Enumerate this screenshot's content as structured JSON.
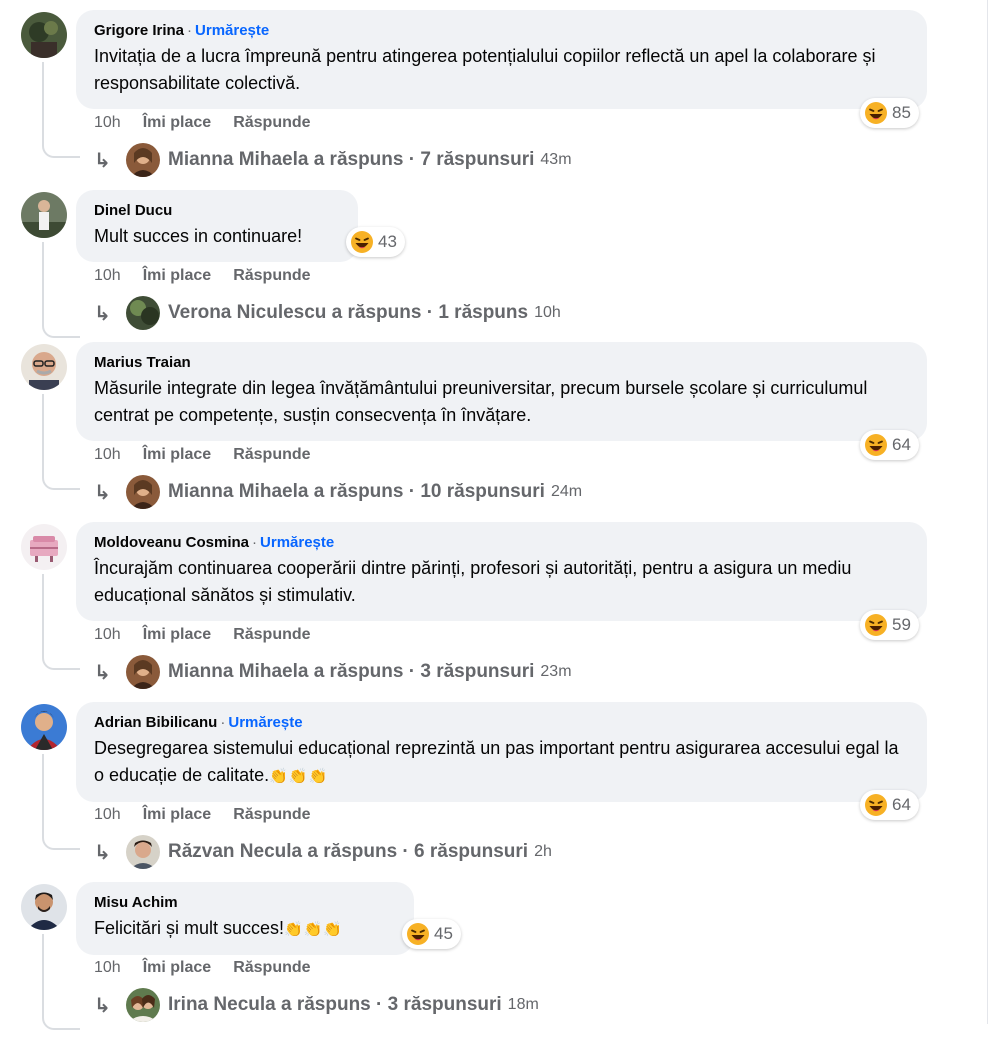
{
  "comments": [
    {
      "author": "Grigore Irina",
      "follow": "Urmărește",
      "text": "Invitația de a lucra împreună pentru atingerea potențialului copiilor reflectă un apel la colaborare și responsabilitate colectivă.",
      "reaction_count": "85",
      "time": "10h",
      "like": "Îmi place",
      "reply": "Răspunde",
      "reply_summary": "Mianna Mihaela a răspuns · 7 răspunsuri",
      "reply_time": "43m"
    },
    {
      "author": "Dinel Ducu",
      "follow": "",
      "text": "Mult succes in continuare!",
      "reaction_count": "43",
      "time": "10h",
      "like": "Îmi place",
      "reply": "Răspunde",
      "reply_summary": "Verona Niculescu a răspuns · 1 răspuns",
      "reply_time": "10h"
    },
    {
      "author": "Marius Traian",
      "follow": "",
      "text": "Măsurile integrate din legea învățământului preuniversitar, precum bursele școlare și curriculumul centrat pe competențe, susțin consecvența în învățare.",
      "reaction_count": "64",
      "time": "10h",
      "like": "Îmi place",
      "reply": "Răspunde",
      "reply_summary": "Mianna Mihaela a răspuns · 10 răspunsuri",
      "reply_time": "24m"
    },
    {
      "author": "Moldoveanu Cosmina",
      "follow": "Urmărește",
      "text": "Încurajăm continuarea cooperării dintre părinți, profesori și autorități, pentru a asigura un mediu educațional sănătos și stimulativ.",
      "reaction_count": "59",
      "time": "10h",
      "like": "Îmi place",
      "reply": "Răspunde",
      "reply_summary": "Mianna Mihaela a răspuns · 3 răspunsuri",
      "reply_time": "23m"
    },
    {
      "author": "Adrian Bibilicanu",
      "follow": "Urmărește",
      "text": "Desegregarea sistemului educațional reprezintă un pas important pentru asigurarea accesului egal la o educație de calitate.",
      "text_emoji": "👏👏👏",
      "reaction_count": "64",
      "time": "10h",
      "like": "Îmi place",
      "reply": "Răspunde",
      "reply_summary": "Răzvan Necula a răspuns · 6 răspunsuri",
      "reply_time": "2h"
    },
    {
      "author": "Misu Achim",
      "follow": "",
      "text": "Felicitări și mult succes!",
      "text_emoji": "👏👏👏",
      "reaction_count": "45",
      "time": "10h",
      "like": "Îmi place",
      "reply": "Răspunde",
      "reply_summary": "Irina Necula a răspuns · 3 răspunsuri",
      "reply_time": "18m"
    }
  ],
  "icons": {
    "reaction": "laughing-face-icon",
    "reply_arrow": "reply-arrow-icon"
  },
  "colors": {
    "link": "#0866ff",
    "bubble": "#f0f2f5",
    "muted": "#65676b"
  }
}
